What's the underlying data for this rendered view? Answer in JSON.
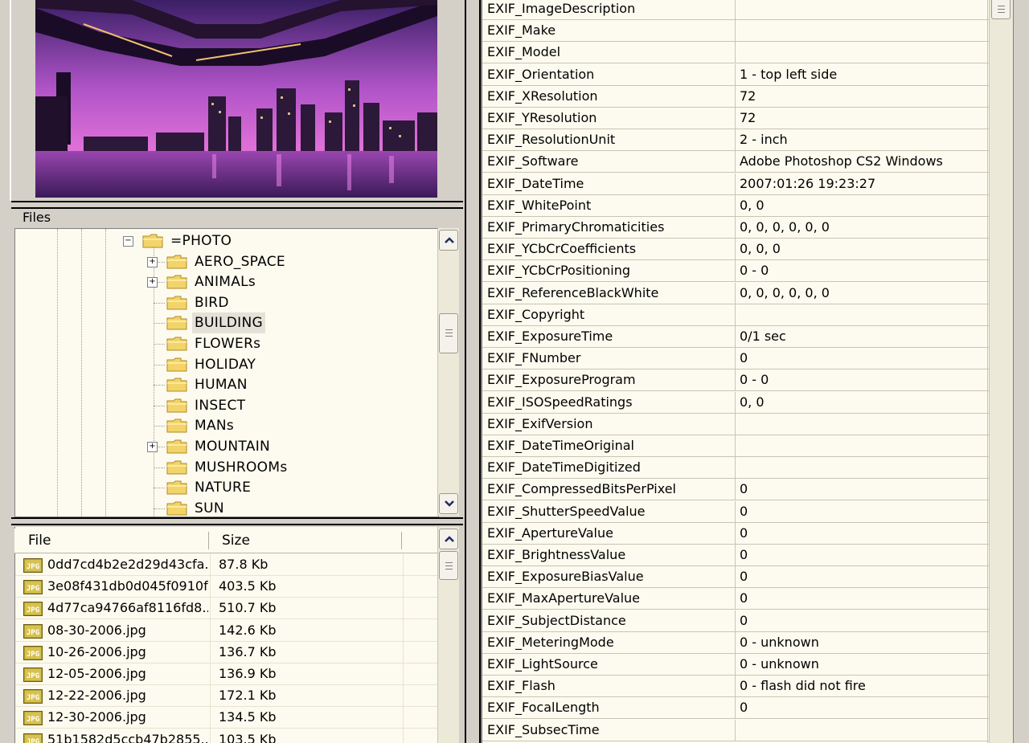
{
  "files_panel": {
    "legend": "Files",
    "tree": [
      {
        "label": "=PHOTO",
        "level": 0,
        "expander": "minus",
        "selected": false
      },
      {
        "label": "AERO_SPACE",
        "level": 1,
        "expander": "plus",
        "selected": false
      },
      {
        "label": "ANIMALs",
        "level": 1,
        "expander": "plus",
        "selected": false
      },
      {
        "label": "BIRD",
        "level": 1,
        "expander": "",
        "selected": false
      },
      {
        "label": "BUILDING",
        "level": 1,
        "expander": "",
        "selected": true
      },
      {
        "label": "FLOWERs",
        "level": 1,
        "expander": "",
        "selected": false
      },
      {
        "label": "HOLIDAY",
        "level": 1,
        "expander": "",
        "selected": false
      },
      {
        "label": "HUMAN",
        "level": 1,
        "expander": "",
        "selected": false
      },
      {
        "label": "INSECT",
        "level": 1,
        "expander": "",
        "selected": false
      },
      {
        "label": "MANs",
        "level": 1,
        "expander": "",
        "selected": false
      },
      {
        "label": "MOUNTAIN",
        "level": 1,
        "expander": "plus",
        "selected": false
      },
      {
        "label": "MUSHROOMs",
        "level": 1,
        "expander": "",
        "selected": false
      },
      {
        "label": "NATURE",
        "level": 1,
        "expander": "",
        "selected": false
      },
      {
        "label": "SUN",
        "level": 1,
        "expander": "",
        "selected": false
      }
    ]
  },
  "file_list": {
    "columns": {
      "file": "File",
      "size": "Size"
    },
    "rows": [
      {
        "name": "0dd7cd4b2e2d29d43cfa...",
        "size": "87.8 Kb"
      },
      {
        "name": "3e08f431db0d045f0910f...",
        "size": "403.5 Kb"
      },
      {
        "name": "4d77ca94766af8116fd8...",
        "size": "510.7 Kb"
      },
      {
        "name": "08-30-2006.jpg",
        "size": "142.6 Kb"
      },
      {
        "name": "10-26-2006.jpg",
        "size": "136.7 Kb"
      },
      {
        "name": "12-05-2006.jpg",
        "size": "136.9 Kb"
      },
      {
        "name": "12-22-2006.jpg",
        "size": "172.1 Kb"
      },
      {
        "name": "12-30-2006.jpg",
        "size": "134.5 Kb"
      },
      {
        "name": "51b1582d5ccb47b2855...",
        "size": "103.5 Kb"
      }
    ],
    "file_icon": "jpg-file-icon"
  },
  "exif": [
    {
      "name": "EXIF_ImageDescription",
      "value": ""
    },
    {
      "name": "EXIF_Make",
      "value": ""
    },
    {
      "name": "EXIF_Model",
      "value": ""
    },
    {
      "name": "EXIF_Orientation",
      "value": "1 - top left side"
    },
    {
      "name": "EXIF_XResolution",
      "value": "72"
    },
    {
      "name": "EXIF_YResolution",
      "value": "72"
    },
    {
      "name": "EXIF_ResolutionUnit",
      "value": "2 - inch"
    },
    {
      "name": "EXIF_Software",
      "value": "Adobe Photoshop CS2 Windows"
    },
    {
      "name": "EXIF_DateTime",
      "value": "2007:01:26 19:23:27"
    },
    {
      "name": "EXIF_WhitePoint",
      "value": "0, 0"
    },
    {
      "name": "EXIF_PrimaryChromaticities",
      "value": "0, 0, 0, 0, 0, 0"
    },
    {
      "name": "EXIF_YCbCrCoefficients",
      "value": "0, 0, 0"
    },
    {
      "name": "EXIF_YCbCrPositioning",
      "value": "0 - 0"
    },
    {
      "name": "EXIF_ReferenceBlackWhite",
      "value": "0, 0, 0, 0, 0, 0"
    },
    {
      "name": "EXIF_Copyright",
      "value": ""
    },
    {
      "name": "EXIF_ExposureTime",
      "value": "0/1 sec"
    },
    {
      "name": "EXIF_FNumber",
      "value": "0"
    },
    {
      "name": "EXIF_ExposureProgram",
      "value": "0 - 0"
    },
    {
      "name": "EXIF_ISOSpeedRatings",
      "value": "0, 0"
    },
    {
      "name": "EXIF_ExifVersion",
      "value": ""
    },
    {
      "name": "EXIF_DateTimeOriginal",
      "value": ""
    },
    {
      "name": "EXIF_DateTimeDigitized",
      "value": ""
    },
    {
      "name": "EXIF_CompressedBitsPerPixel",
      "value": "0"
    },
    {
      "name": "EXIF_ShutterSpeedValue",
      "value": "0"
    },
    {
      "name": "EXIF_ApertureValue",
      "value": "0"
    },
    {
      "name": "EXIF_BrightnessValue",
      "value": "0"
    },
    {
      "name": "EXIF_ExposureBiasValue",
      "value": "0"
    },
    {
      "name": "EXIF_MaxApertureValue",
      "value": "0"
    },
    {
      "name": "EXIF_SubjectDistance",
      "value": "0"
    },
    {
      "name": "EXIF_MeteringMode",
      "value": "0 - unknown"
    },
    {
      "name": "EXIF_LightSource",
      "value": "0 - unknown"
    },
    {
      "name": "EXIF_Flash",
      "value": "0 - flash did not fire"
    },
    {
      "name": "EXIF_FocalLength",
      "value": "0"
    },
    {
      "name": "EXIF_SubsecTime",
      "value": ""
    }
  ],
  "colors": {
    "panel_bg": "#fdfbef",
    "chrome": "#d4d0c8",
    "folder": "#f3d46a",
    "selected": "#e4e1d8"
  },
  "icons": {
    "tree_folder": "folder-icon",
    "scroll_up": "chevron-up-icon",
    "scroll_down": "chevron-down-icon"
  }
}
